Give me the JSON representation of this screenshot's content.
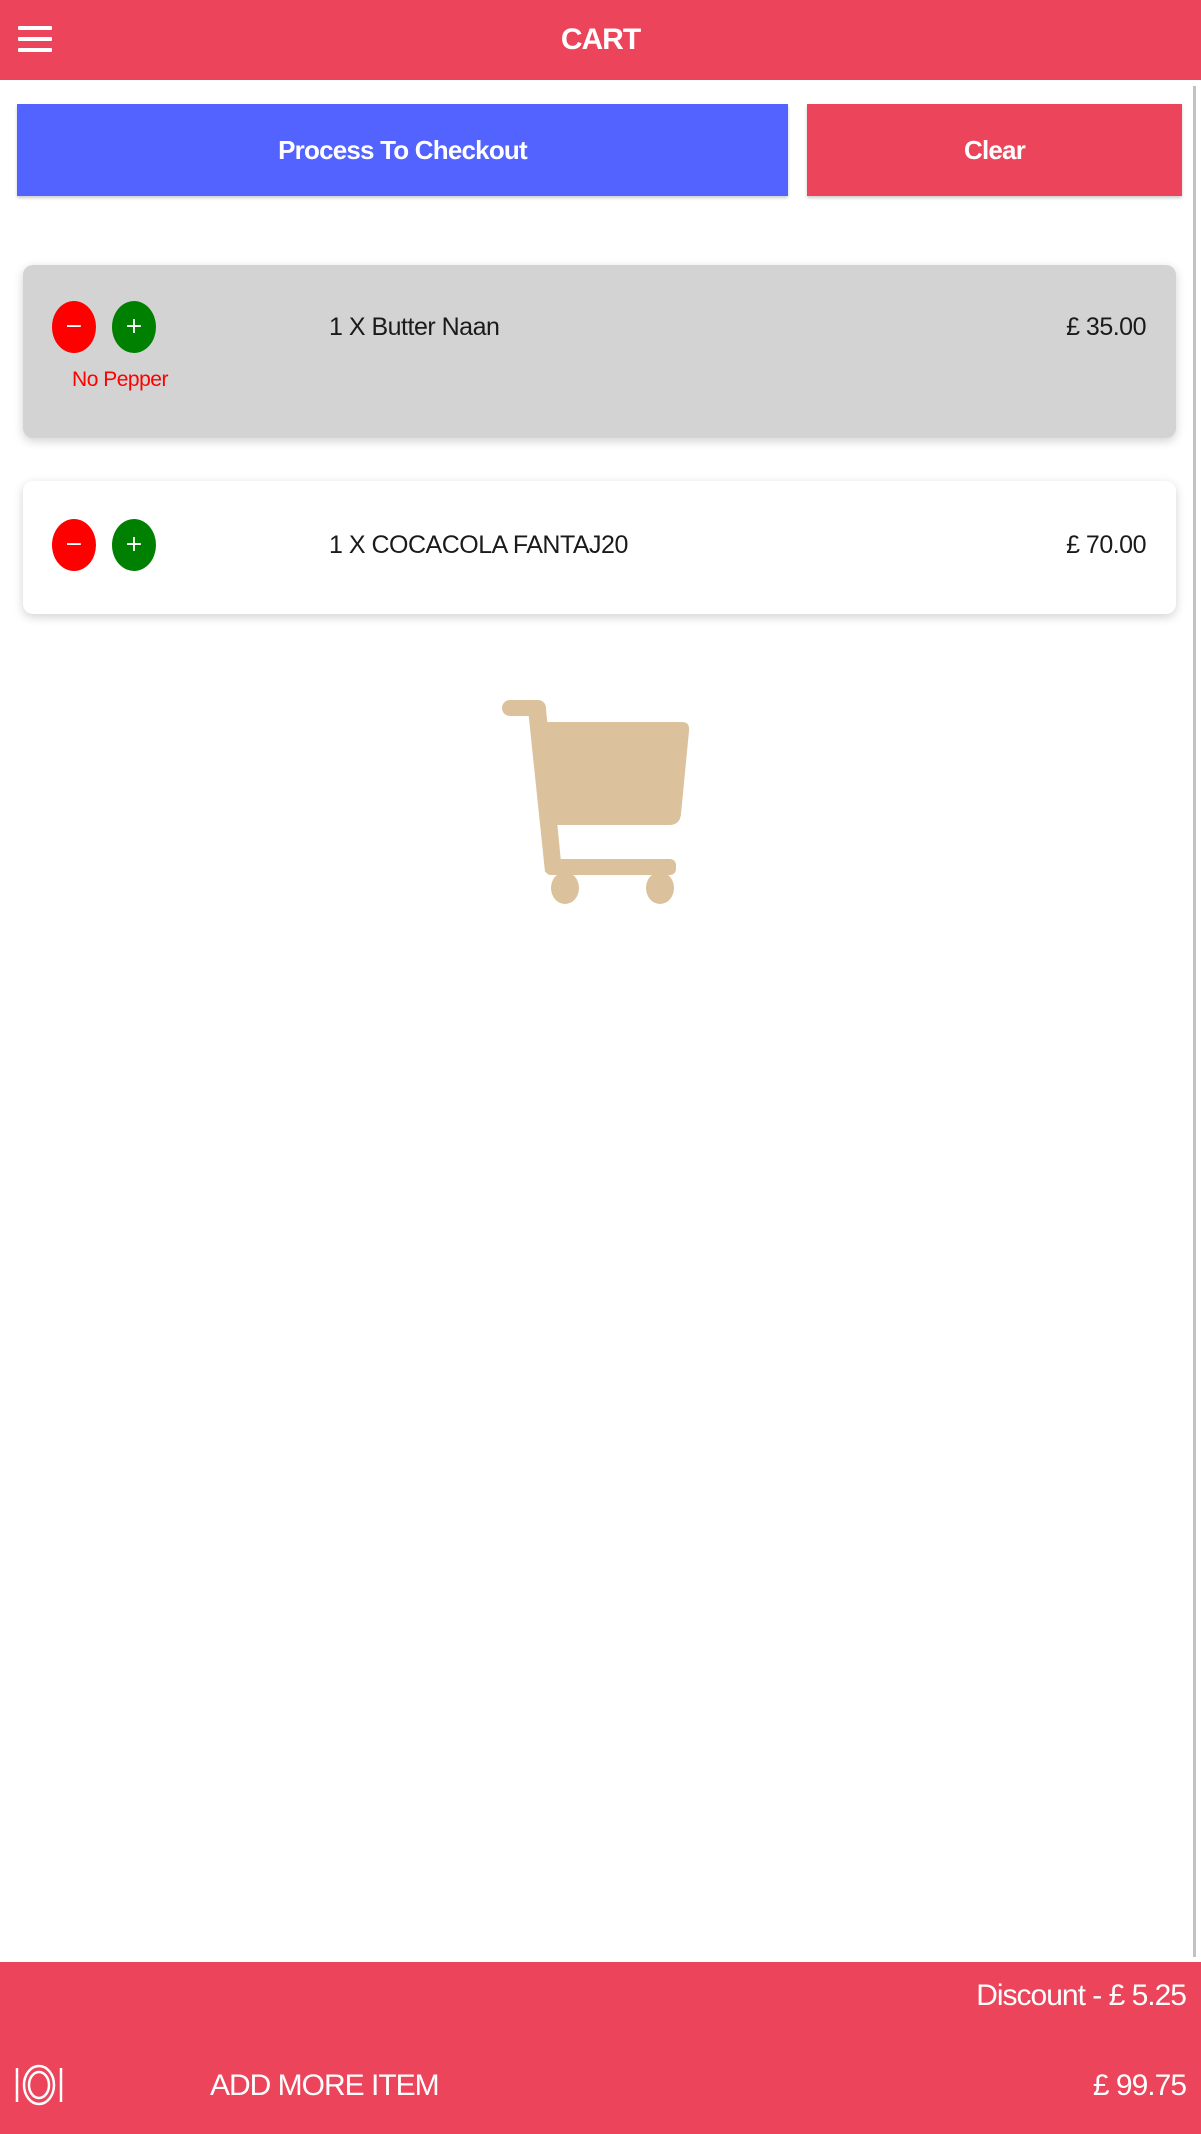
{
  "header": {
    "title": "CART",
    "menu_icon": "hamburger-menu-icon"
  },
  "actions": {
    "checkout_label": "Process To Checkout",
    "clear_label": "Clear"
  },
  "cart_items": [
    {
      "quantity": "1",
      "name_display": "1 X  Butter Naan",
      "price": "£ 35.00",
      "note": "No Pepper",
      "highlighted": true,
      "decrease_symbol": "−",
      "increase_symbol": "+"
    },
    {
      "quantity": "1",
      "name_display": "1 X  COCACOLA FANTAJ20",
      "price": "£ 70.00",
      "note": "",
      "highlighted": false,
      "decrease_symbol": "−",
      "increase_symbol": "+"
    }
  ],
  "illustration": {
    "icon": "shopping-cart-icon",
    "color": "#dbc29c"
  },
  "footer": {
    "discount": "Discount - £ 5.25",
    "add_more_label": "ADD MORE ITEM",
    "total": "£ 99.75",
    "icon": "plate-cutlery-icon"
  },
  "colors": {
    "primary": "#ec445b",
    "checkout": "#5263ff",
    "decrease": "#ff0000",
    "increase": "#008000",
    "note": "#ff0000",
    "highlight_row": "#d3d3d3"
  }
}
